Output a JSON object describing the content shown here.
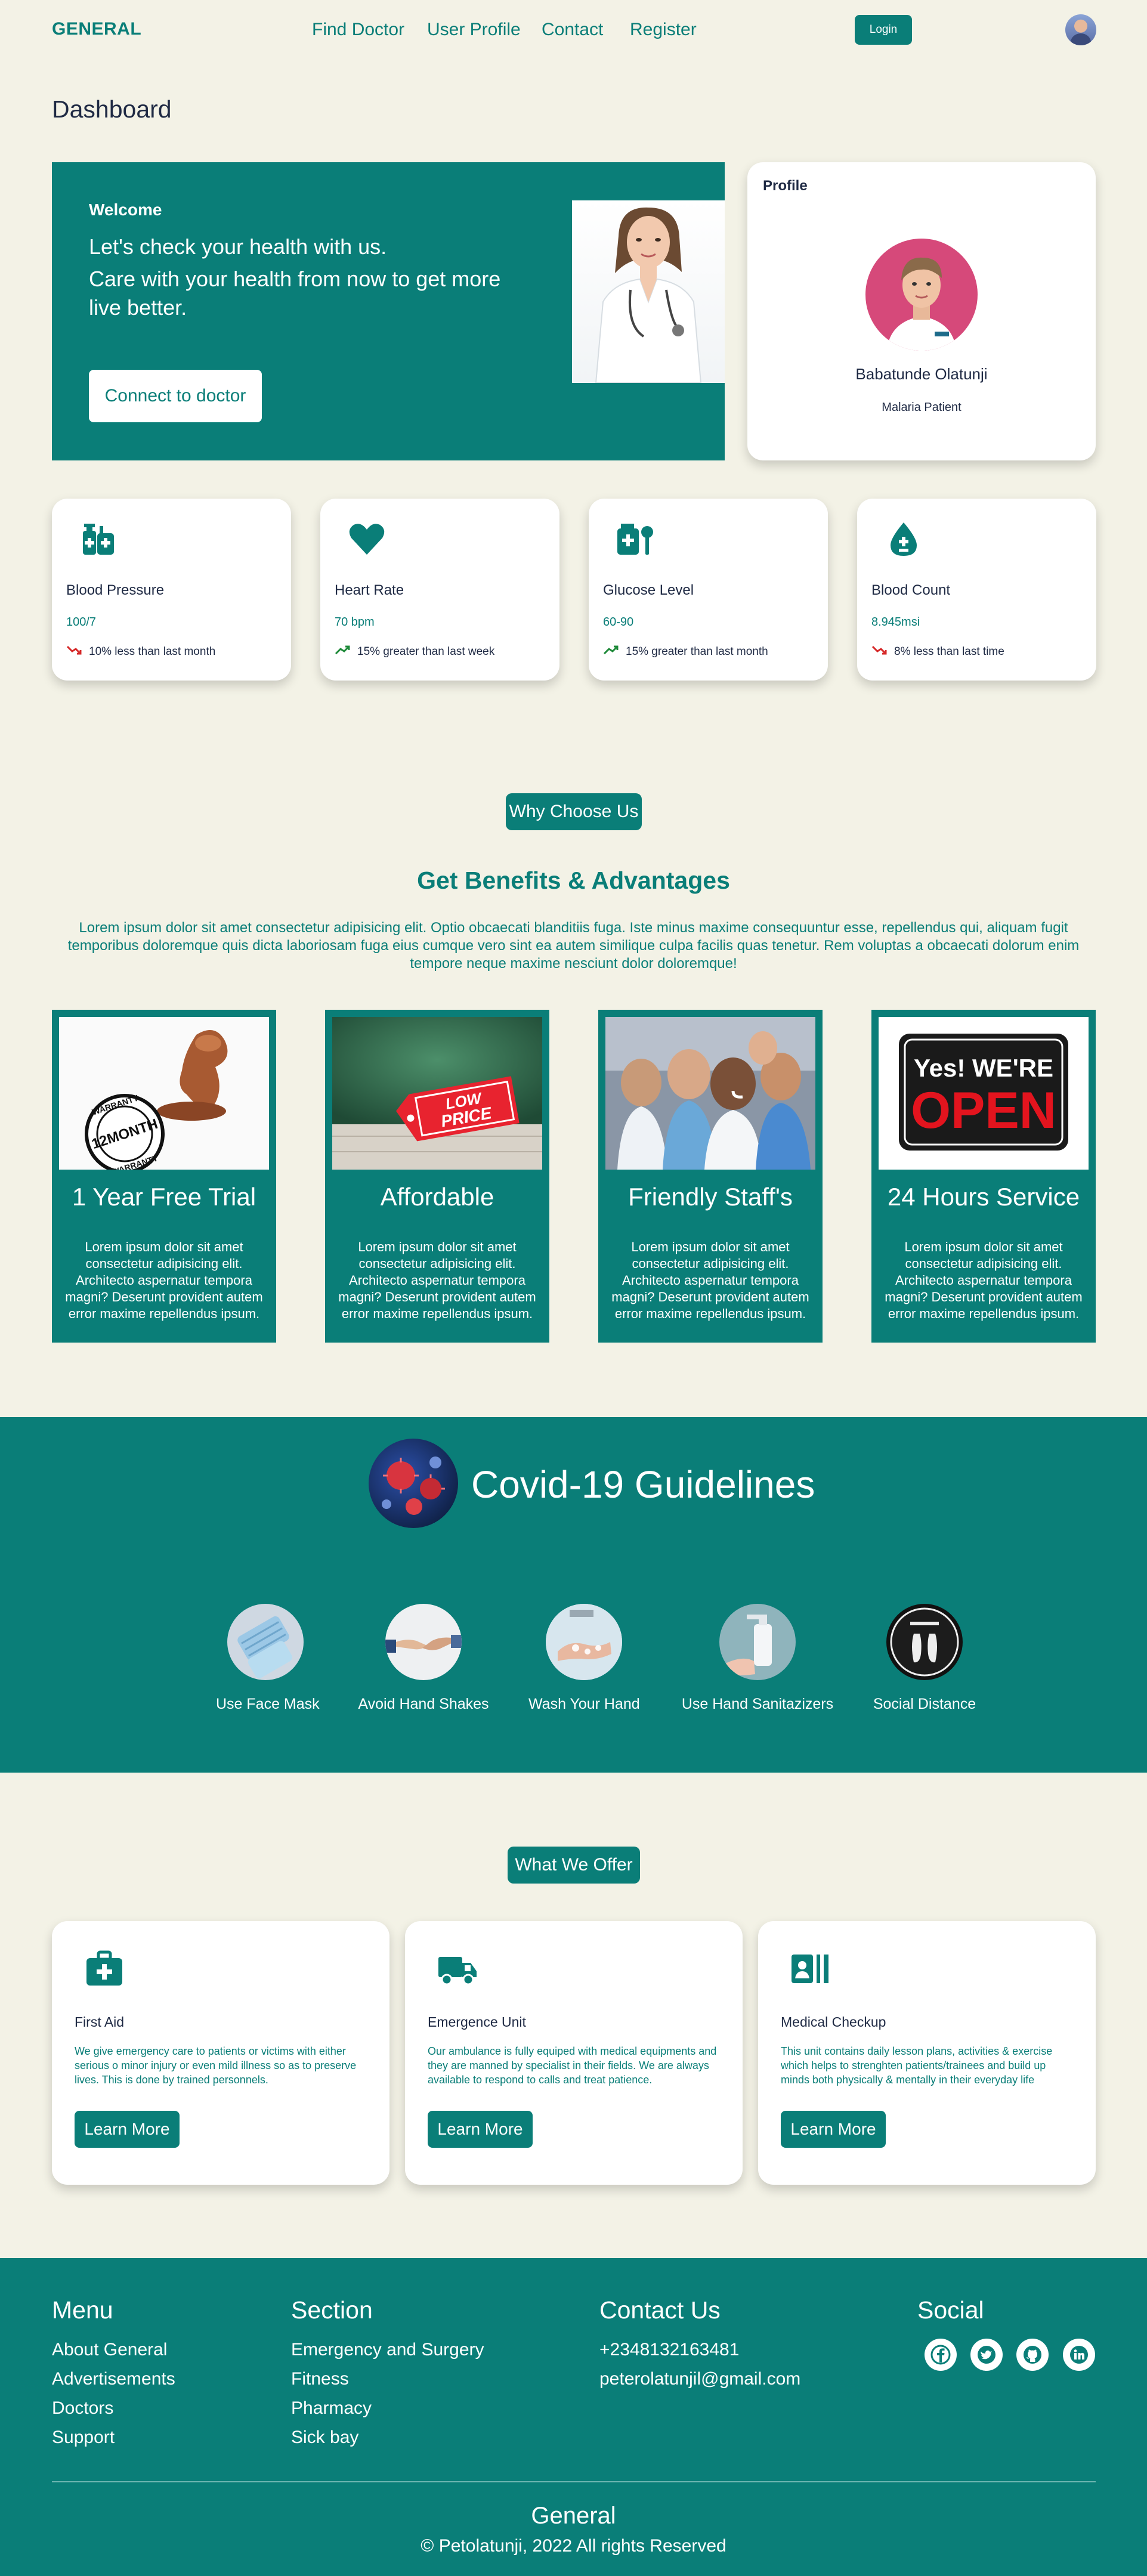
{
  "nav": {
    "logo": "GENERAL",
    "links": [
      "Find Doctor",
      "User Profile",
      "Contact",
      "Register"
    ],
    "login_label": "Login"
  },
  "dashboard": {
    "title": "Dashboard",
    "welcome": {
      "title": "Welcome",
      "line1": "Let's check your health with us.",
      "line2": "Care with your health from now to get more",
      "line3": "live better.",
      "button_label": "Connect to doctor"
    },
    "profile": {
      "title": "Profile",
      "name": "Babatunde Olatunji",
      "role": "Malaria Patient"
    },
    "stats": [
      {
        "icon": "medical-kit-icon",
        "label": "Blood Pressure",
        "value": "100/7",
        "trend": "down",
        "trend_text": "10% less than last month"
      },
      {
        "icon": "heart-icon",
        "label": "Heart Rate",
        "value": "70 bpm",
        "trend": "up",
        "trend_text": "15% greater than last week"
      },
      {
        "icon": "glucose-meter-icon",
        "label": "Glucose Level",
        "value": "60-90",
        "trend": "up",
        "trend_text": "15% greater than last month"
      },
      {
        "icon": "blood-drop-icon",
        "label": "Blood Count",
        "value": "8.945msi",
        "trend": "down",
        "trend_text": "8% less than last time"
      }
    ]
  },
  "why": {
    "pill": "Why Choose Us",
    "heading": "Get Benefits & Advantages",
    "lorem": "Lorem ipsum dolor sit amet consectetur adipisicing elit. Optio obcaecati blanditiis fuga. Iste minus maxime consequuntur esse, repellendus qui, aliquam fugit temporibus doloremque quis dicta laboriosam fuga eius cumque vero sint ea autem similique culpa facilis quas tenetur. Rem voluptas a obcaecati dolorum enim tempore neque maxime nesciunt dolor doloremque!",
    "benefits": [
      {
        "title": "1 Year Free Trial",
        "image": "warranty-stamp",
        "stamp_text": "12MONTH",
        "stamp_ring": "WARRANTY",
        "text": "Lorem ipsum dolor sit amet consectetur adipisicing elit. Architecto aspernatur tempora magni? Deserunt provident autem error maxime repellendus ipsum."
      },
      {
        "title": "Affordable",
        "image": "low-price-tag",
        "tag_line1": "LOW",
        "tag_line2": "PRICE",
        "text": "Lorem ipsum dolor sit amet consectetur adipisicing elit. Architecto aspernatur tempora magni? Deserunt provident autem error maxime repellendus ipsum."
      },
      {
        "title": "Friendly Staff's",
        "image": "medical-staff-photo",
        "text": "Lorem ipsum dolor sit amet consectetur adipisicing elit. Architecto aspernatur tempora magni? Deserunt provident autem error maxime repellendus ipsum."
      },
      {
        "title": "24 Hours Service",
        "image": "open-sign",
        "sign_line1": "Yes! WE'RE",
        "sign_line2": "OPEN",
        "text": "Lorem ipsum dolor sit amet consectetur adipisicing elit. Architecto aspernatur tempora magni? Deserunt provident autem error maxime repellendus ipsum."
      }
    ]
  },
  "covid": {
    "title": "Covid-19 Guidelines",
    "guidelines": [
      {
        "label": "Use Face Mask",
        "image": "face-mask"
      },
      {
        "label": "Avoid Hand Shakes",
        "image": "handshake"
      },
      {
        "label": "Wash Your Hand",
        "image": "hand-wash"
      },
      {
        "label": "Use Hand Sanitazizers",
        "image": "sanitizer"
      },
      {
        "label": "Social Distance",
        "image": "social-distance"
      }
    ]
  },
  "offer": {
    "pill": "What We Offer",
    "items": [
      {
        "icon": "first-aid-kit-icon",
        "title": "First Aid",
        "text": "We give emergency care to patients or victims with either serious o minor injury or even mild illness so as to preserve lives. This is done by trained personnels.",
        "button": "Learn More"
      },
      {
        "icon": "truck-icon",
        "title": "Emergence Unit",
        "text": "Our ambulance is fully equiped with medical equipments and they are manned by specialist in their fields. We are always available to respond to calls and treat patience.",
        "button": "Learn More"
      },
      {
        "icon": "medical-id-icon",
        "title": "Medical Checkup",
        "text": "This unit contains daily lesson plans, activities & exercise which helps to strenghten patients/trainees and build up minds both physically & mentally in their everyday life",
        "button": "Learn More"
      }
    ]
  },
  "footer": {
    "menu": {
      "title": "Menu",
      "links": [
        "About General",
        "Advertisements",
        "Doctors",
        "Support"
      ]
    },
    "section": {
      "title": "Section",
      "links": [
        "Emergency and Surgery",
        "Fitness",
        "Pharmacy",
        "Sick bay"
      ]
    },
    "contact": {
      "title": "Contact Us",
      "phone": "+2348132163481",
      "email": "peterolatunjil@gmail.com"
    },
    "social": {
      "title": "Social",
      "icons": [
        "facebook-icon",
        "twitter-icon",
        "github-icon",
        "linkedin-icon"
      ]
    },
    "brand": "General",
    "copyright": "© Petolatunji, 2022 All rights Reserved"
  },
  "colors": {
    "primary": "#0a7e78",
    "background": "#f3f2e6",
    "text": "#1f2a44",
    "trend_down": "#d62828",
    "trend_up": "#1f8a3a"
  }
}
